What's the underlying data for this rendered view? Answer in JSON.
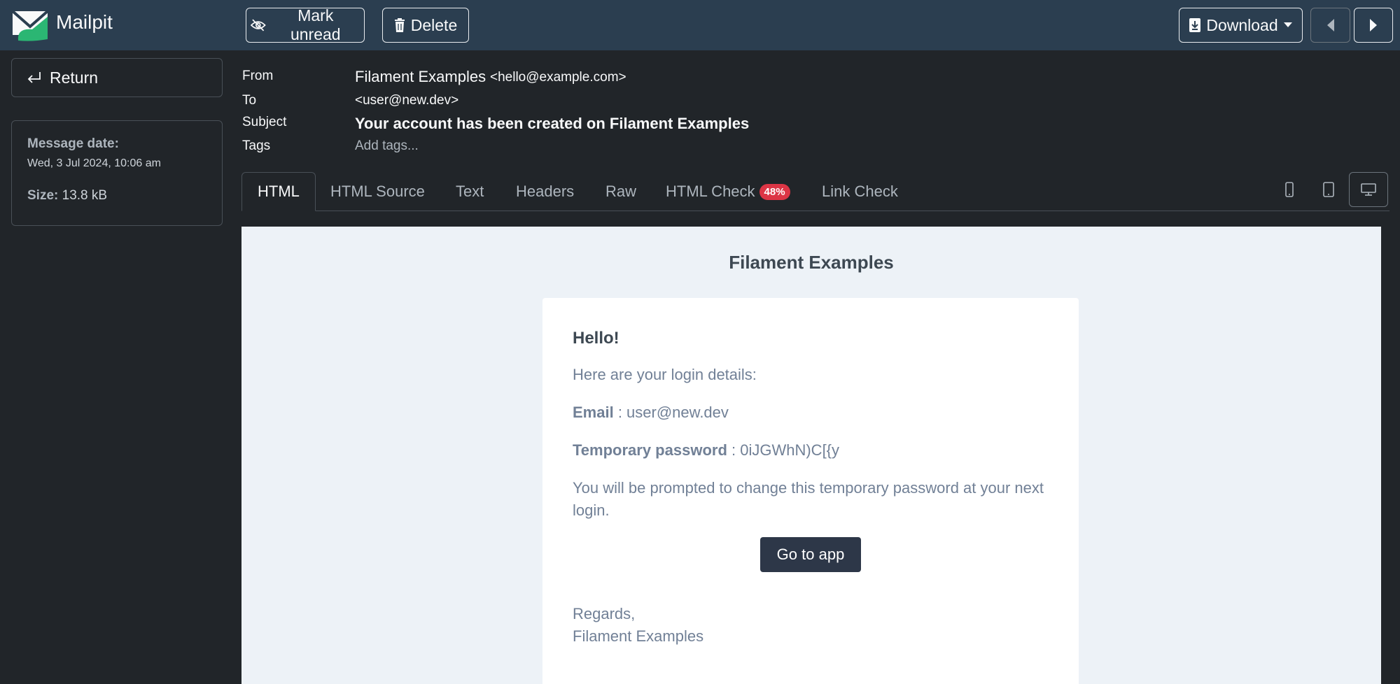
{
  "app": {
    "name": "Mailpit"
  },
  "toolbar": {
    "mark_unread": "Mark unread",
    "delete": "Delete",
    "download": "Download"
  },
  "sidebar": {
    "return_label": "Return",
    "message_date_label": "Message date:",
    "message_date": "Wed, 3 Jul 2024, 10:06 am",
    "size_label": "Size:",
    "size": "13.8 kB"
  },
  "headers": {
    "from_label": "From",
    "from_name": "Filament Examples",
    "from_email": "<hello@example.com>",
    "to_label": "To",
    "to": "<user@new.dev>",
    "subject_label": "Subject",
    "subject": "Your account has been created on Filament Examples",
    "tags_label": "Tags",
    "tags_placeholder": "Add tags..."
  },
  "tabs": [
    {
      "label": "HTML",
      "active": true
    },
    {
      "label": "HTML Source"
    },
    {
      "label": "Text"
    },
    {
      "label": "Headers"
    },
    {
      "label": "Raw"
    },
    {
      "label": "HTML Check",
      "badge": "48%"
    },
    {
      "label": "Link Check"
    }
  ],
  "email": {
    "title": "Filament Examples",
    "greeting": "Hello!",
    "intro": "Here are your login details:",
    "email_label": "Email",
    "email_sep": " : ",
    "email_value": "user@new.dev",
    "password_label": "Temporary password",
    "password_sep": " : ",
    "password_value": "0iJGWhN)C[{y",
    "notice": "You will be prompted to change this temporary password at your next login.",
    "button": "Go to app",
    "regards": "Regards,",
    "signature": "Filament Examples"
  },
  "colors": {
    "navbar": "#2b3e50",
    "page_bg": "#212529",
    "preview_bg": "#edf2f7",
    "badge": "#dc3545",
    "cta": "#2d3748",
    "logo_green": "#2bb673"
  }
}
